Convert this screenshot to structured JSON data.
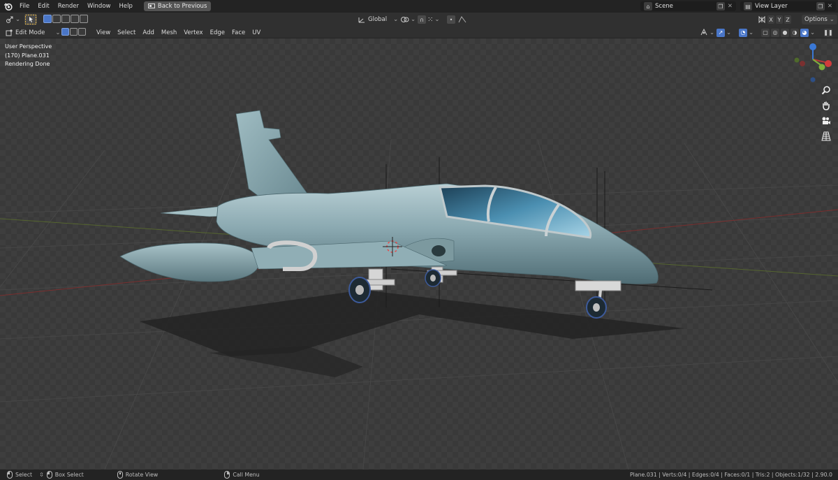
{
  "menubar": {
    "items": [
      "File",
      "Edit",
      "Render",
      "Window",
      "Help"
    ],
    "back_button": "Back to Previous",
    "scene": "Scene",
    "view_layer": "View Layer"
  },
  "tool_header": {
    "orientation": "Global",
    "options": "Options",
    "axes": [
      "X",
      "Y",
      "Z"
    ]
  },
  "viewport_header": {
    "mode": "Edit Mode",
    "menus": [
      "View",
      "Select",
      "Add",
      "Mesh",
      "Vertex",
      "Edge",
      "Face",
      "UV"
    ]
  },
  "viewport": {
    "perspective": "User Perspective",
    "object": "(170) Plane.031",
    "status": "Rendering Done"
  },
  "statusbar": {
    "select": "Select",
    "box_select": "Box Select",
    "rotate_view": "Rotate View",
    "call_menu": "Call Menu",
    "stats": "Plane.031 | Verts:0/4 | Edges:0/4 | Faces:0/1 | Tris:2 | Objects:1/32 | 2.90.0"
  },
  "colors": {
    "accent": "#4a76c7",
    "aircraft": "#7e9ea6",
    "canopy": "#3d7a98",
    "grid": "#444444",
    "x_axis": "#b43a3a",
    "y_axis": "#7fae3c",
    "z_axis": "#3a78d6"
  }
}
